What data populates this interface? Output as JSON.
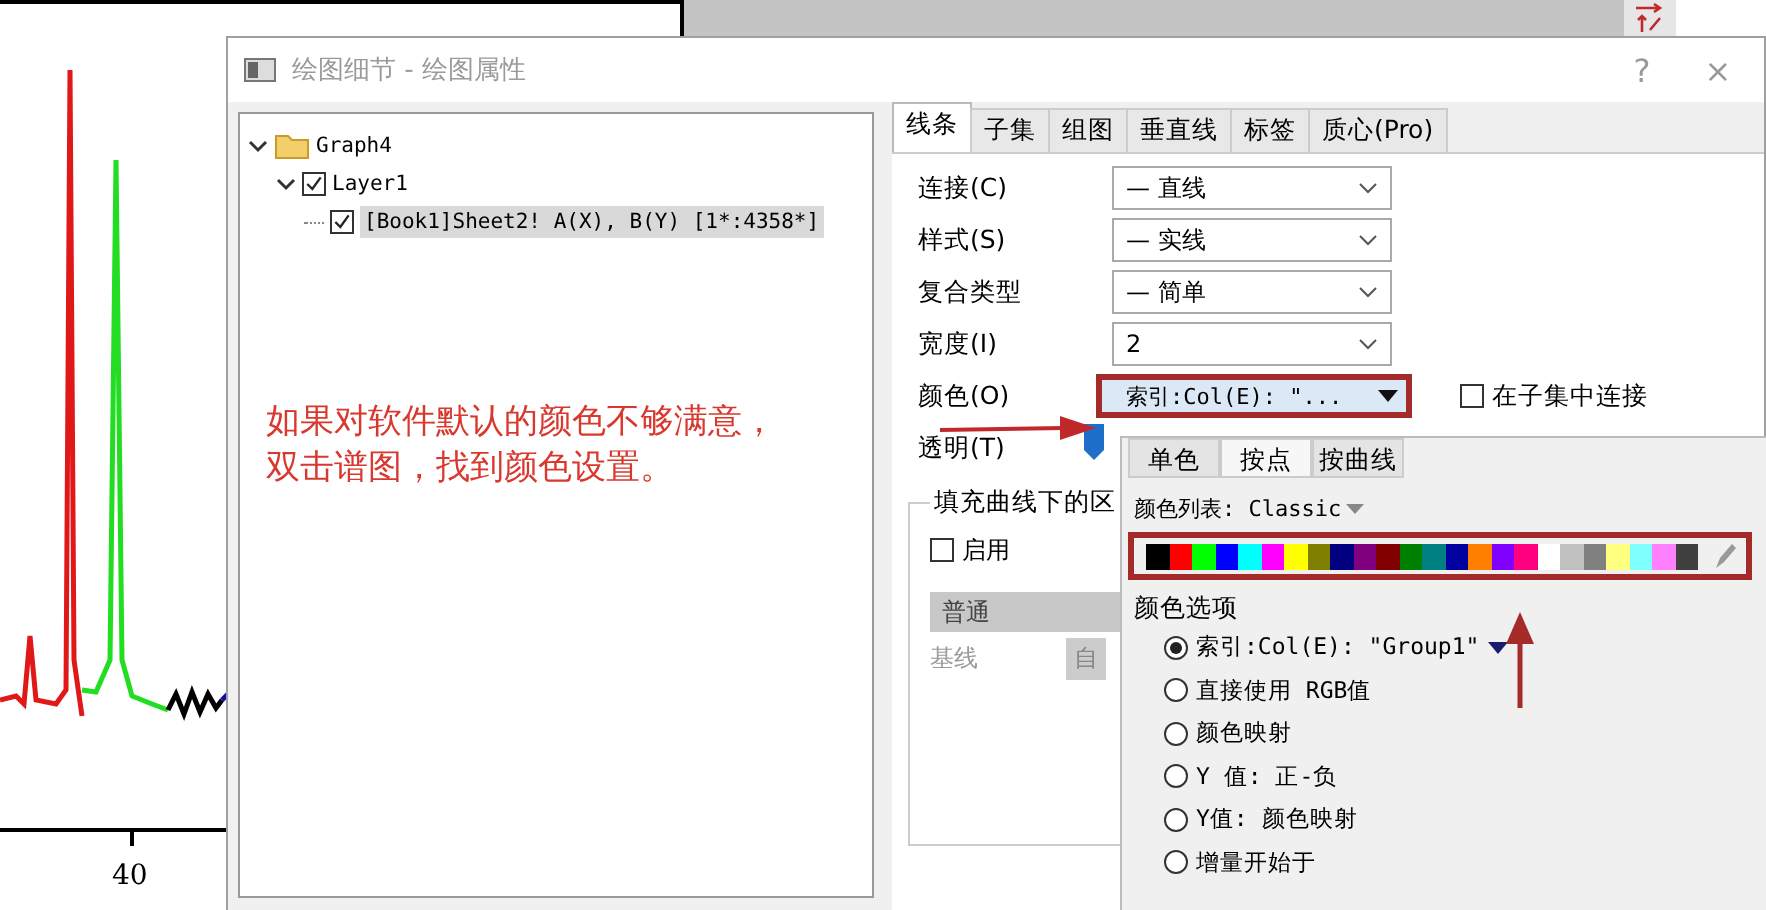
{
  "plot": {
    "x_tick_label": "40"
  },
  "dialog": {
    "title": "绘图细节 - 绘图属性",
    "help": "?",
    "close": "×",
    "tree": [
      {
        "label": "Graph4",
        "kind": "folder",
        "expanded": true,
        "selected": false,
        "children": [
          {
            "label": "Layer1",
            "checked": true,
            "expanded": true,
            "selected": false,
            "children": [
              {
                "label": "[Book1]Sheet2! A(X), B(Y) [1*:4358*]",
                "checked": true,
                "selected": true
              }
            ]
          }
        ]
      }
    ],
    "tabs": [
      {
        "label": "线条",
        "selected": true
      },
      {
        "label": "子集",
        "selected": false
      },
      {
        "label": "组图",
        "selected": false
      },
      {
        "label": "垂直线",
        "selected": false
      },
      {
        "label": "标签",
        "selected": false
      },
      {
        "label": "质心(Pro)",
        "selected": false
      }
    ],
    "fields": [
      {
        "label": "连接(C)",
        "kind": "select",
        "value": "— 直线"
      },
      {
        "label": "样式(S)",
        "kind": "select",
        "value": "— 实线"
      },
      {
        "label": "复合类型",
        "kind": "select",
        "value": "— 简单"
      },
      {
        "label": "宽度(I)",
        "kind": "select",
        "value": "2"
      },
      {
        "label": "颜色(O)",
        "kind": "color",
        "value": "索引:Col(E): \"...",
        "highlighted": true
      }
    ],
    "connect_in_subset": {
      "label": "在子集中连接",
      "checked": false
    },
    "transparency_label": "透明(T)",
    "fill_group": {
      "legend": "填充曲线下的区",
      "enable": {
        "label": "启用",
        "checked": false
      },
      "mode": "普通",
      "baseline_label": "基线",
      "baseline_button": "自"
    }
  },
  "popup": {
    "tabs": [
      {
        "label": "单色",
        "selected": false
      },
      {
        "label": "按点",
        "selected": true
      },
      {
        "label": "按曲线",
        "selected": false
      }
    ],
    "color_list_label": "颜色列表: Classic",
    "swatches": [
      {
        "color": "#000000"
      },
      {
        "color": "#ff0000"
      },
      {
        "color": "#00ff00"
      },
      {
        "color": "#0000ff"
      },
      {
        "color": "#00ffff"
      },
      {
        "color": "#ff00ff"
      },
      {
        "color": "#ffff00"
      },
      {
        "color": "#808000"
      },
      {
        "color": "#000080"
      },
      {
        "color": "#800080"
      },
      {
        "color": "#800000"
      },
      {
        "color": "#008000"
      },
      {
        "color": "#008080"
      },
      {
        "color": "#0000a0"
      },
      {
        "color": "#ff8000"
      },
      {
        "color": "#8000ff"
      },
      {
        "color": "#ff0080"
      },
      {
        "color": "#ffffff"
      },
      {
        "color": "#c0c0c0"
      },
      {
        "color": "#808080"
      },
      {
        "color": "#ffff80"
      },
      {
        "color": "#80ffff"
      },
      {
        "color": "#ff80ff"
      },
      {
        "color": "#404040"
      }
    ],
    "options_label": "颜色选项",
    "options": [
      {
        "label": "索引:Col(E): \"Group1\"",
        "selected": true,
        "dropdown": true
      },
      {
        "label": "直接使用 RGB值",
        "selected": false
      },
      {
        "label": "颜色映射",
        "selected": false
      },
      {
        "label": "Y 值: 正-负",
        "selected": false
      },
      {
        "label": "Y值: 颜色映射",
        "selected": false
      },
      {
        "label": "增量开始于",
        "selected": false
      }
    ]
  },
  "annotation": {
    "lines": [
      "如果对软件默认的颜色不够满意，",
      "双击谱图，找到颜色设置。"
    ]
  }
}
